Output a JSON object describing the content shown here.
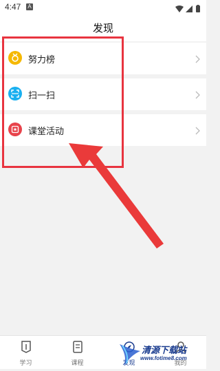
{
  "status_bar": {
    "time": "4:47",
    "notification": "A"
  },
  "header": {
    "title": "发现"
  },
  "menu": [
    {
      "label": "努力榜",
      "icon": "medal-icon",
      "color": "#f5b800"
    },
    {
      "label": "扫一扫",
      "icon": "scan-icon",
      "color": "#1ab0f0"
    },
    {
      "label": "课堂活动",
      "icon": "star-badge-icon",
      "color": "#e8434b"
    }
  ],
  "bottom_nav": [
    {
      "label": "学习",
      "icon": "study-icon"
    },
    {
      "label": "课程",
      "icon": "course-icon"
    },
    {
      "label": "发现",
      "icon": "discover-icon",
      "active": true
    },
    {
      "label": "我的",
      "icon": "profile-icon"
    }
  ],
  "watermark": {
    "text": "清源下载站",
    "url": "www.fotime8.com"
  },
  "colors": {
    "highlight": "#e8343f",
    "accent": "#1a3c8f"
  }
}
